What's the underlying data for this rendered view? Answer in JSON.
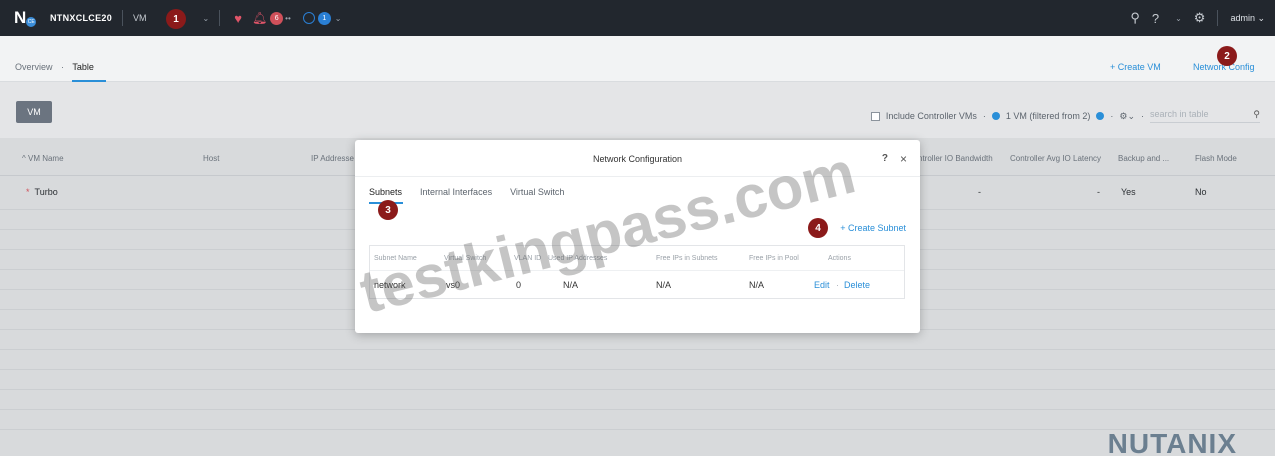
{
  "topbar": {
    "cluster_name": "NTNXCLCE20",
    "menu_label": "VM",
    "alerts_count": "6",
    "tasks_count": "1",
    "user": "admin"
  },
  "subnav": {
    "crumb_overview": "Overview",
    "crumb_sep": "·",
    "crumb_table": "Table",
    "create_vm": "+ Create VM",
    "network_config": "Network Config"
  },
  "toolbar": {
    "vm_button": "VM",
    "include_cvm": "Include Controller VMs",
    "filter_text": "1 VM (filtered from 2)",
    "search_placeholder": "search in table"
  },
  "table": {
    "headers": [
      "^ VM Name",
      "Host",
      "IP Addresse",
      "ntroller IO Bandwidth",
      "Controller Avg IO Latency",
      "Backup and ...",
      "Flash Mode"
    ],
    "rows": [
      {
        "name": "Turbo",
        "bandwidth": "-",
        "latency": "-",
        "backup": "Yes",
        "flash": "No"
      }
    ]
  },
  "modal": {
    "title": "Network Configuration",
    "help": "?",
    "close": "×",
    "tabs": [
      "Subnets",
      "Internal Interfaces",
      "Virtual Switch"
    ],
    "create_subnet": "+ Create Subnet",
    "columns": [
      "Subnet Name",
      "Virtual Switch",
      "VLAN ID",
      "Used IP Addresses",
      "Free IPs in Subnets",
      "Free IPs in Pool",
      "Actions"
    ],
    "row": {
      "name": "network",
      "switch": "vs0",
      "vlan": "0",
      "used": "N/A",
      "free_subnet": "N/A",
      "free_pool": "N/A",
      "edit": "Edit",
      "delete": "Delete"
    }
  },
  "markers": [
    "1",
    "2",
    "3",
    "4"
  ],
  "watermark": "testkingpass.com",
  "brand": "NUTANIX"
}
